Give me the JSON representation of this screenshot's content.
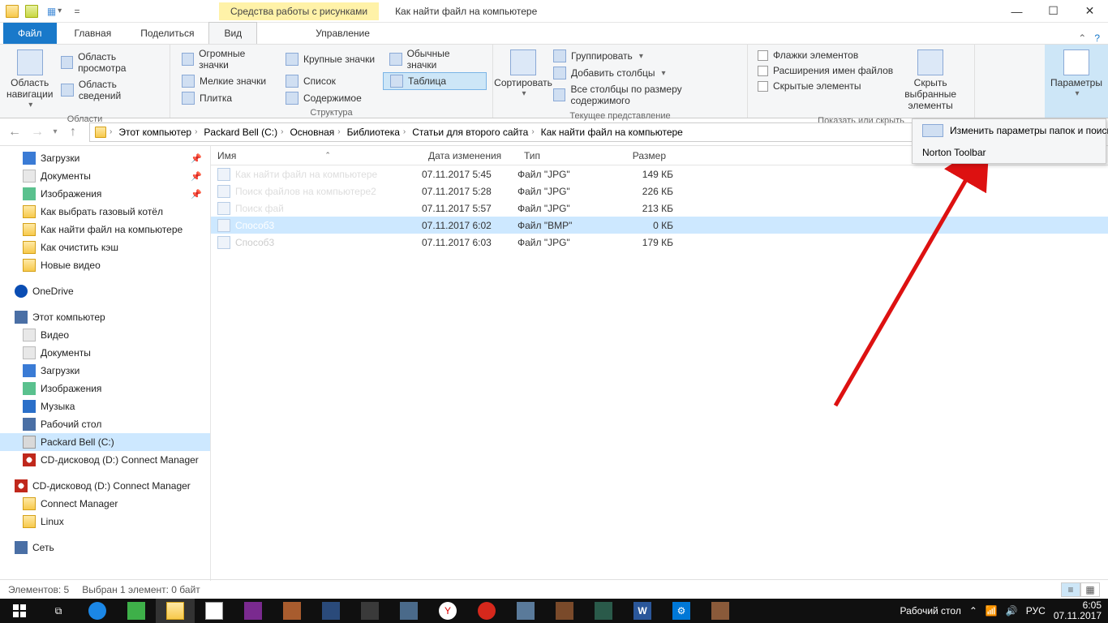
{
  "title": {
    "context_tab": "Средства работы с рисунками",
    "window": "Как найти файл на компьютере"
  },
  "tabs": {
    "file": "Файл",
    "home": "Главная",
    "share": "Поделиться",
    "view": "Вид",
    "manage": "Управление"
  },
  "ribbon": {
    "panes": {
      "navpane": "Область навигации",
      "preview": "Область просмотра",
      "details": "Область сведений",
      "grp": "Области"
    },
    "layout": {
      "huge": "Огромные значки",
      "large": "Крупные значки",
      "medium": "Обычные значки",
      "small": "Мелкие значки",
      "list": "Список",
      "details": "Таблица",
      "tiles": "Плитка",
      "content": "Содержимое",
      "grp": "Структура"
    },
    "view": {
      "sort": "Сортировать",
      "group": "Группировать",
      "addcols": "Добавить столбцы",
      "fitcols": "Все столбцы по размеру содержимого",
      "grp": "Текущее представление"
    },
    "showhide": {
      "checkboxes": "Флажки элементов",
      "extensions": "Расширения имен файлов",
      "hidden": "Скрытые элементы",
      "hidesel": "Скрыть выбранные элементы",
      "grp": "Показать или скрыть"
    },
    "options": {
      "btn": "Параметры",
      "m1": "Изменить параметры папок и поиска",
      "m2": "Norton Toolbar"
    }
  },
  "breadcrumbs": [
    "Этот компьютер",
    "Packard Bell (C:)",
    "Основная",
    "Библиотека",
    "Статьи для второго сайта",
    "Как найти файл на компьютере"
  ],
  "tree": {
    "downloads": "Загрузки",
    "documents": "Документы",
    "pictures": "Изображения",
    "f1": "Как выбрать газовый котёл",
    "f2": "Как найти файл на компьютере",
    "f3": "Как очистить кэш",
    "f4": "Новые видео",
    "onedrive": "OneDrive",
    "thispc": "Этот компьютер",
    "videos": "Видео",
    "documents2": "Документы",
    "downloads2": "Загрузки",
    "pictures2": "Изображения",
    "music": "Музыка",
    "desktop": "Рабочий стол",
    "cdrive": "Packard Bell (C:)",
    "dvd": "CD-дисковод (D:) Connect Manager",
    "dvd2": "CD-дисковод (D:) Connect Manager",
    "cm": "Connect Manager",
    "linux": "Linux",
    "network": "Сеть"
  },
  "columns": {
    "name": "Имя",
    "date": "Дата изменения",
    "type": "Тип",
    "size": "Размер"
  },
  "files": [
    {
      "name": "Как найти файл на компьютере",
      "date": "07.11.2017 5:45",
      "type": "Файл \"JPG\"",
      "size": "149 КБ"
    },
    {
      "name": "Поиск файлов на компьютере2",
      "date": "07.11.2017 5:28",
      "type": "Файл \"JPG\"",
      "size": "226 КБ"
    },
    {
      "name": "Поиск фай",
      "date": "07.11.2017 5:57",
      "type": "Файл \"JPG\"",
      "size": "213 КБ"
    },
    {
      "name": "Способ3",
      "date": "07.11.2017 6:02",
      "type": "Файл \"BMP\"",
      "size": "0 КБ"
    },
    {
      "name": "Способ3",
      "date": "07.11.2017 6:03",
      "type": "Файл \"JPG\"",
      "size": "179 КБ"
    }
  ],
  "status": {
    "count": "Элементов: 5",
    "sel": "Выбран 1 элемент: 0 байт"
  },
  "taskbar": {
    "desktop": "Рабочий стол",
    "lang": "РУС",
    "time": "6:05",
    "date": "07.11.2017"
  }
}
